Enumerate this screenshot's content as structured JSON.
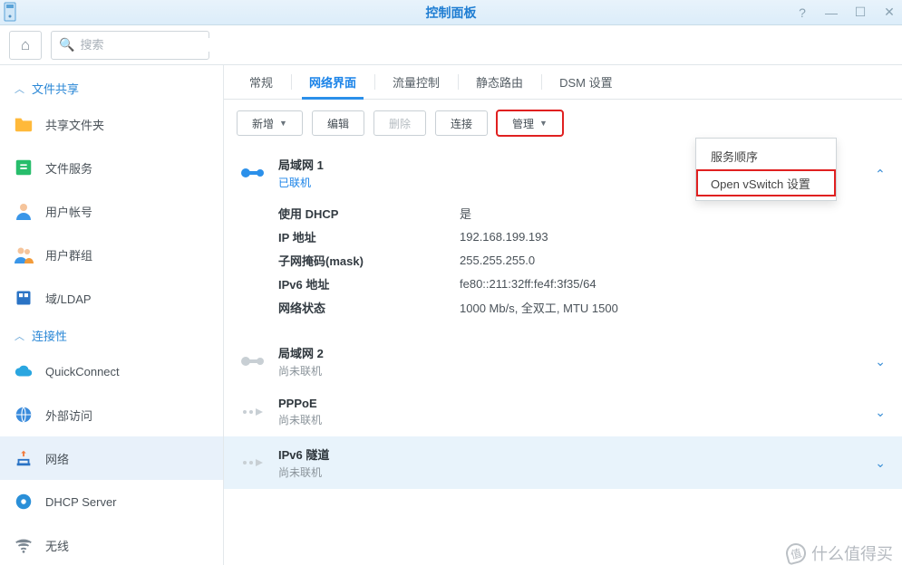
{
  "window": {
    "title": "控制面板"
  },
  "search": {
    "placeholder": "搜索"
  },
  "sidebar": {
    "section1": "文件共享",
    "items1": [
      {
        "label": "共享文件夹"
      },
      {
        "label": "文件服务"
      },
      {
        "label": "用户帐号"
      },
      {
        "label": "用户群组"
      },
      {
        "label": "域/LDAP"
      }
    ],
    "section2": "连接性",
    "items2": [
      {
        "label": "QuickConnect"
      },
      {
        "label": "外部访问"
      },
      {
        "label": "网络"
      },
      {
        "label": "DHCP Server"
      },
      {
        "label": "无线"
      }
    ]
  },
  "tabs": [
    {
      "label": "常规"
    },
    {
      "label": "网络界面"
    },
    {
      "label": "流量控制"
    },
    {
      "label": "静态路由"
    },
    {
      "label": "DSM 设置"
    }
  ],
  "toolbar": {
    "new": "新增",
    "edit": "编辑",
    "delete": "删除",
    "connect": "连接",
    "manage": "管理"
  },
  "menu": {
    "order": "服务顺序",
    "ovs": "Open vSwitch 设置"
  },
  "net": {
    "lan1": {
      "title": "局域网 1",
      "status": "已联机"
    },
    "rows": [
      {
        "label": "使用 DHCP",
        "value": "是"
      },
      {
        "label": "IP 地址",
        "value": "192.168.199.193"
      },
      {
        "label": "子网掩码(mask)",
        "value": "255.255.255.0"
      },
      {
        "label": "IPv6 地址",
        "value": "fe80::211:32ff:fe4f:3f35/64"
      },
      {
        "label": "网络状态",
        "value": "1000 Mb/s, 全双工, MTU 1500"
      }
    ],
    "lan2": {
      "title": "局域网 2",
      "status": "尚未联机"
    },
    "pppoe": {
      "title": "PPPoE",
      "status": "尚未联机"
    },
    "ipv6": {
      "title": "IPv6 隧道",
      "status": "尚未联机"
    }
  },
  "watermark": "什么值得买"
}
